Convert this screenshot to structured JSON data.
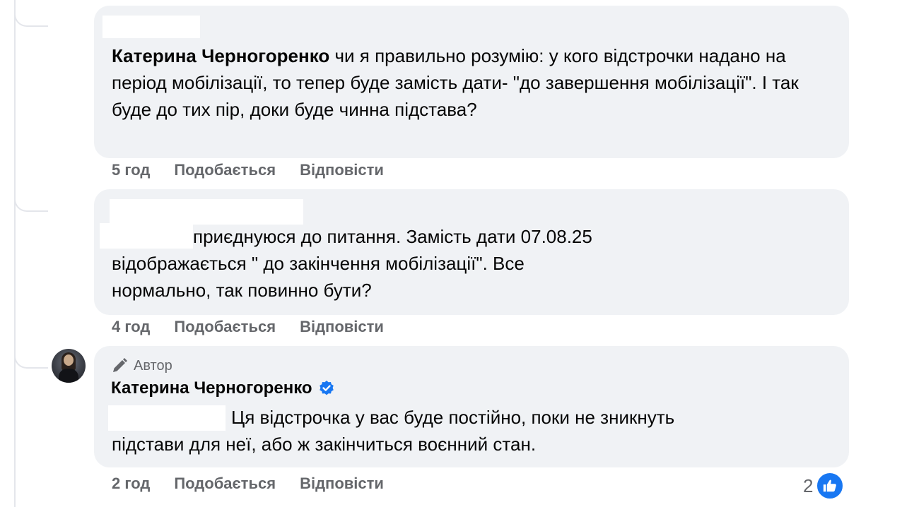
{
  "comments": [
    {
      "author": "Катерина Черногоренко",
      "text": " чи я правильно розумію: у кого відстрочки надано на період мобілізації, то тепер буде замість дати- \"до завершення мобілізації\". І так буде до тих пір, доки буде чинна підстава?",
      "time": "5 год",
      "like_label": "Подобається",
      "reply_label": "Відповісти"
    },
    {
      "text_line1": "приєднуюся до питання. Замість дати 07.08.25",
      "text_rest": "відображається \" до закінчення мобілізації\". Все нормально, так повинно бути?",
      "time": "4 год",
      "like_label": "Подобається",
      "reply_label": "Відповісти"
    },
    {
      "badge": "Автор",
      "author": "Катерина Черногоренко",
      "text_line1": "Ця відстрочка у вас буде постійно, поки не зникнуть",
      "text_rest": "підстави для неї, або ж закінчиться воєнний стан.",
      "time": "2 год",
      "like_label": "Подобається",
      "reply_label": "Відповісти",
      "reaction_count": "2"
    }
  ],
  "icons": {
    "author_badge": "pencil-icon",
    "verified": "verified-badge-icon",
    "reaction": "thumbs-up-icon"
  },
  "colors": {
    "bubble": "#f0f2f5",
    "meta_text": "#65676b",
    "accent": "#1877f2"
  }
}
